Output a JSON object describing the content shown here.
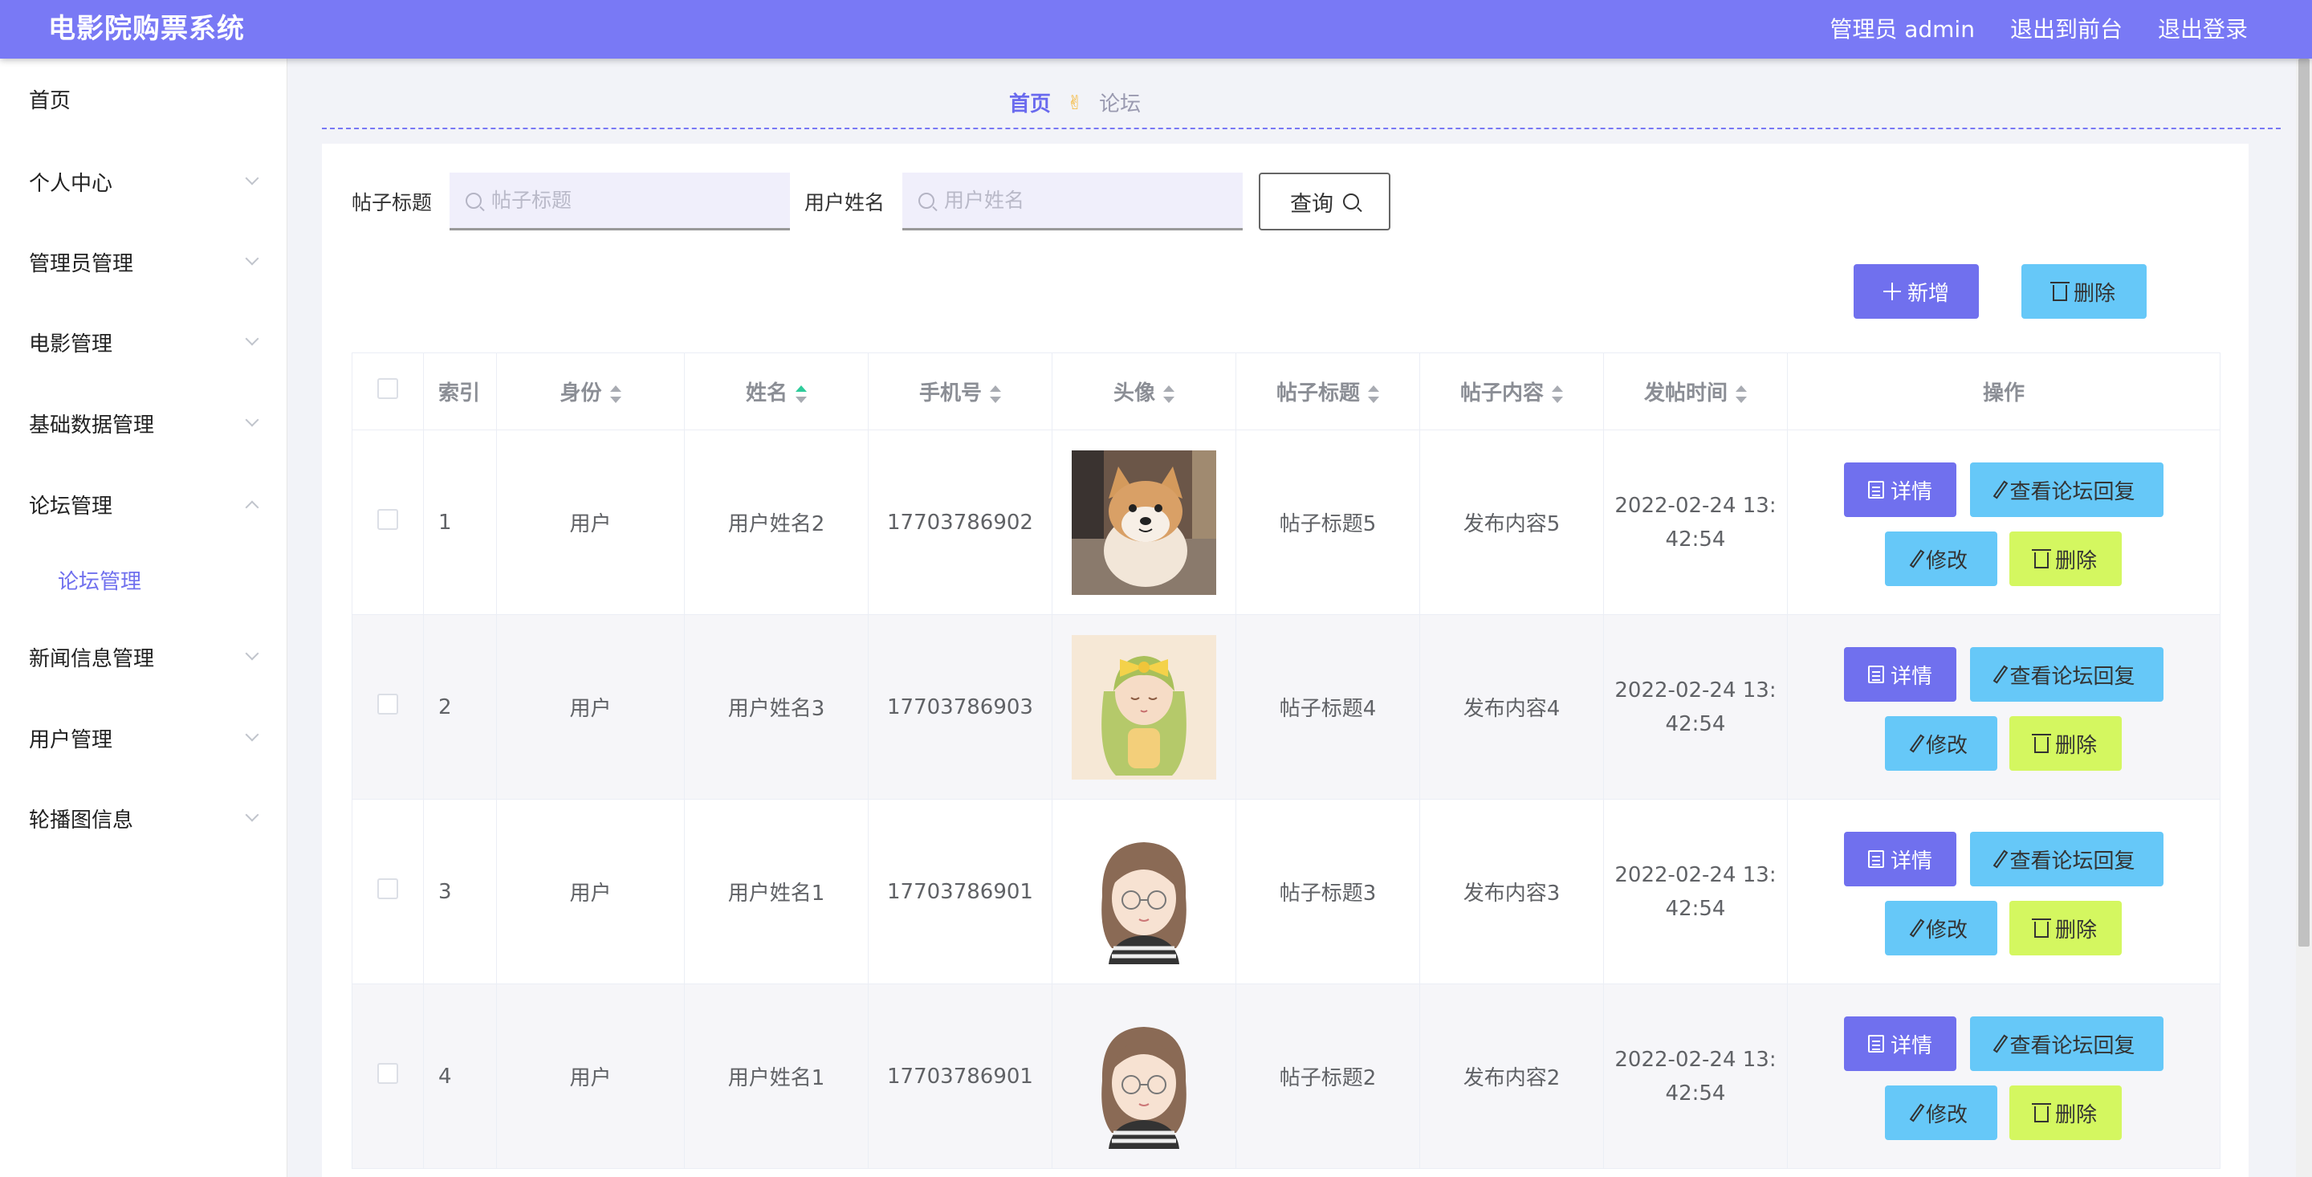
{
  "app": {
    "title": "电影院购票系统"
  },
  "topnav": {
    "admin": "管理员 admin",
    "front": "退出到前台",
    "logout": "退出登录"
  },
  "sidebar": {
    "items": [
      {
        "label": "首页"
      },
      {
        "label": "个人中心"
      },
      {
        "label": "管理员管理"
      },
      {
        "label": "电影管理"
      },
      {
        "label": "基础数据管理"
      },
      {
        "label": "论坛管理"
      },
      {
        "label": "新闻信息管理"
      },
      {
        "label": "用户管理"
      },
      {
        "label": "轮播图信息"
      }
    ],
    "sub": {
      "label": "论坛管理"
    }
  },
  "breadcrumb": {
    "home": "首页",
    "separator": "✌",
    "current": "论坛"
  },
  "search": {
    "title_label": "帖子标题",
    "title_placeholder": "帖子标题",
    "name_label": "用户姓名",
    "name_placeholder": "用户姓名",
    "query": "查询"
  },
  "actions": {
    "add": "新增",
    "delete": "删除"
  },
  "table": {
    "headers": {
      "index": "索引",
      "identity": "身份",
      "name": "姓名",
      "phone": "手机号",
      "avatar": "头像",
      "title": "帖子标题",
      "content": "帖子内容",
      "time": "发帖时间",
      "ops": "操作"
    },
    "rows": [
      {
        "index": "1",
        "identity": "用户",
        "name": "用户姓名2",
        "phone": "17703786902",
        "avatar": "shiba-dog-photo",
        "title": "帖子标题5",
        "content": "发布内容5",
        "time_a": "2022-02-24 13:",
        "time_b": "42:54"
      },
      {
        "index": "2",
        "identity": "用户",
        "name": "用户姓名3",
        "phone": "17703786903",
        "avatar": "anime-girl-illustration",
        "title": "帖子标题4",
        "content": "发布内容4",
        "time_a": "2022-02-24 13:",
        "time_b": "42:54"
      },
      {
        "index": "3",
        "identity": "用户",
        "name": "用户姓名1",
        "phone": "17703786901",
        "avatar": "cartoon-girl-glasses",
        "title": "帖子标题3",
        "content": "发布内容3",
        "time_a": "2022-02-24 13:",
        "time_b": "42:54"
      },
      {
        "index": "4",
        "identity": "用户",
        "name": "用户姓名1",
        "phone": "17703786901",
        "avatar": "cartoon-girl-glasses",
        "title": "帖子标题2",
        "content": "发布内容2",
        "time_a": "2022-02-24 13:",
        "time_b": "42:54"
      }
    ],
    "row_ops": {
      "detail": "详情",
      "reply": "查看论坛回复",
      "edit": "修改",
      "remove": "删除"
    }
  },
  "colors": {
    "accent": "#7979f5",
    "info": "#66c8f8",
    "warning": "#d4f760",
    "sort_active": "#2ecc9b"
  }
}
